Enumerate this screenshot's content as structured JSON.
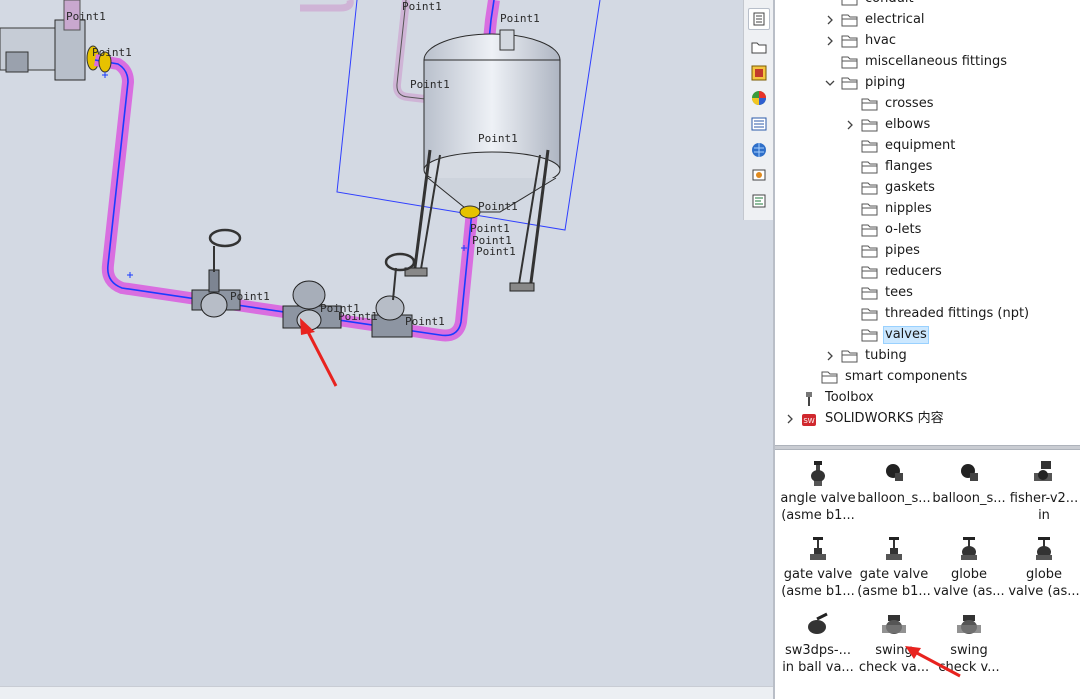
{
  "viewport": {
    "point_labels": [
      "Point1",
      "Point1",
      "Point1",
      "Point1",
      "Point1",
      "Point1",
      "Point1",
      "Point1",
      "Point1",
      "Point1",
      "Point1",
      "Point1",
      "Point1",
      "Point1"
    ]
  },
  "tree": {
    "items": [
      {
        "label": "conduit",
        "indent": 1,
        "chevron": "none"
      },
      {
        "label": "electrical",
        "indent": 1,
        "chevron": "collapsed"
      },
      {
        "label": "hvac",
        "indent": 1,
        "chevron": "collapsed"
      },
      {
        "label": "miscellaneous fittings",
        "indent": 1,
        "chevron": "none"
      },
      {
        "label": "piping",
        "indent": 1,
        "chevron": "expanded"
      },
      {
        "label": "crosses",
        "indent": 2,
        "chevron": "none"
      },
      {
        "label": "elbows",
        "indent": 2,
        "chevron": "collapsed"
      },
      {
        "label": "equipment",
        "indent": 2,
        "chevron": "none"
      },
      {
        "label": "flanges",
        "indent": 2,
        "chevron": "none"
      },
      {
        "label": "gaskets",
        "indent": 2,
        "chevron": "none"
      },
      {
        "label": "nipples",
        "indent": 2,
        "chevron": "none"
      },
      {
        "label": "o-lets",
        "indent": 2,
        "chevron": "none"
      },
      {
        "label": "pipes",
        "indent": 2,
        "chevron": "none"
      },
      {
        "label": "reducers",
        "indent": 2,
        "chevron": "none"
      },
      {
        "label": "tees",
        "indent": 2,
        "chevron": "none"
      },
      {
        "label": "threaded fittings (npt)",
        "indent": 2,
        "chevron": "none"
      },
      {
        "label": "valves",
        "indent": 2,
        "chevron": "none",
        "selected": true
      },
      {
        "label": "tubing",
        "indent": 1,
        "chevron": "collapsed"
      },
      {
        "label": "smart components",
        "indent": 0,
        "chevron": "none"
      },
      {
        "label": "Toolbox",
        "indent": -1,
        "chevron": "none",
        "icon": "toolbox-icon"
      },
      {
        "label": "SOLIDWORKS 内容",
        "indent": -1,
        "chevron": "collapsed",
        "icon": "solidworks-content-icon"
      }
    ]
  },
  "palette": {
    "items": [
      {
        "line1": "angle valve",
        "line2": "(asme b1...",
        "icon": "angle-valve-icon"
      },
      {
        "line1": "balloon_s...",
        "line2": "",
        "icon": "balloon-valve-icon"
      },
      {
        "line1": "balloon_s...",
        "line2": "",
        "icon": "balloon-valve-icon"
      },
      {
        "line1": "fisher-v2...",
        "line2": "in",
        "icon": "fisher-valve-icon"
      },
      {
        "line1": "gate valve",
        "line2": "(asme b1...",
        "icon": "gate-valve-icon"
      },
      {
        "line1": "gate valve",
        "line2": "(asme b1...",
        "icon": "gate-valve-icon"
      },
      {
        "line1": "globe",
        "line2": "valve (as...",
        "icon": "globe-valve-icon"
      },
      {
        "line1": "globe",
        "line2": "valve (as...",
        "icon": "globe-valve-icon"
      },
      {
        "line1": "sw3dps-...",
        "line2": "in ball va...",
        "icon": "ball-valve-icon"
      },
      {
        "line1": "swing",
        "line2": "check va...",
        "icon": "swing-check-valve-icon"
      },
      {
        "line1": "swing",
        "line2": "check v...",
        "icon": "swing-check-valve-icon"
      }
    ]
  },
  "sidebar_icons": [
    "parts-icon",
    "file-explorer-icon",
    "view-palette-icon",
    "appearances-icon",
    "custom-properties-icon",
    "solidworks-resources-icon",
    "design-library-icon",
    "forum-icon"
  ],
  "colors": {
    "pipe": "#d96ee0",
    "route": "#1a3cff",
    "annotation_arrow": "#e8231f",
    "selection": "#cce8ff"
  }
}
